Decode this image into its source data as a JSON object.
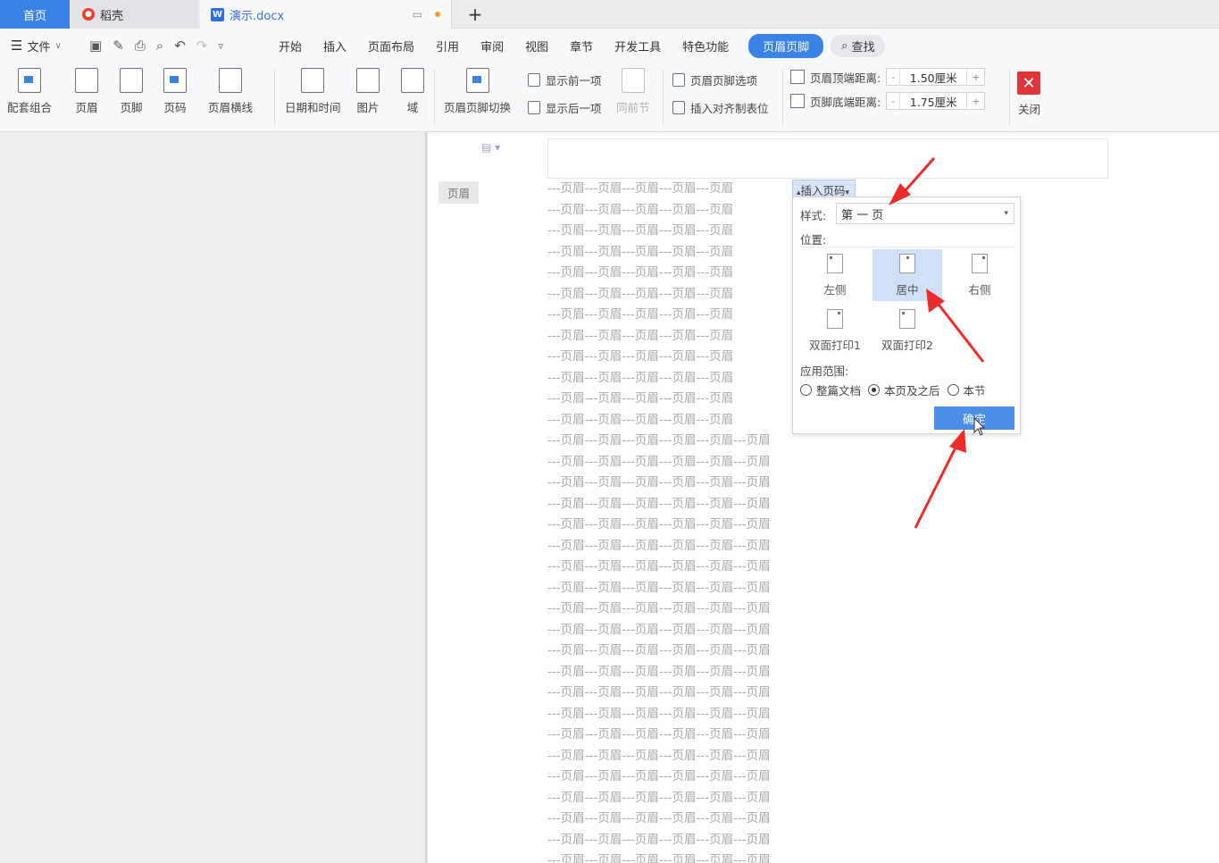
{
  "tabs": {
    "home": "首页",
    "daoke": "稻壳",
    "doc": "演示.docx",
    "new": "+"
  },
  "menubar": {
    "file": "文件",
    "items": [
      "开始",
      "插入",
      "页面布局",
      "引用",
      "审阅",
      "视图",
      "章节",
      "开发工具",
      "特色功能"
    ],
    "active": "页眉页脚",
    "search": "查找"
  },
  "ribbon": {
    "peitao": "配套组合",
    "yemei": "页眉",
    "yejiao": "页脚",
    "yema": "页码",
    "hengxian": "页眉横线",
    "riqi": "日期和时间",
    "tupian": "图片",
    "yu": "域",
    "qiehuan": "页眉页脚切换",
    "show_prev": "显示前一项",
    "show_next": "显示后一项",
    "same_section": "同前节",
    "hf_options": "页眉页脚选项",
    "insert_tab": "插入对齐制表位",
    "header_top_label": "页眉顶端距离:",
    "header_top_value": "1.50厘米",
    "footer_bottom_label": "页脚底端距离:",
    "footer_bottom_value": "1.75厘米",
    "minus": "-",
    "plus": "+",
    "close": "关闭"
  },
  "document": {
    "header_tag": "页眉",
    "line_text_long": "---页眉---页眉---页眉---页眉---页眉---页眉",
    "line_text_short": "---页眉---页眉---页眉---页眉---页眉"
  },
  "popup": {
    "title": "插入页码",
    "style_label": "样式:",
    "style_value": "第 一 页",
    "position_label": "位置:",
    "positions": {
      "left": "左侧",
      "center": "居中",
      "right": "右侧",
      "duplex1": "双面打印1",
      "duplex2": "双面打印2"
    },
    "scope_label": "应用范围:",
    "scope": {
      "whole": "整篇文档",
      "after": "本页及之后",
      "section": "本节"
    },
    "ok": "确定"
  },
  "colors": {
    "accent": "#3b82e6",
    "close_red": "#e0353a",
    "arrow_red": "#ee2b2b"
  }
}
